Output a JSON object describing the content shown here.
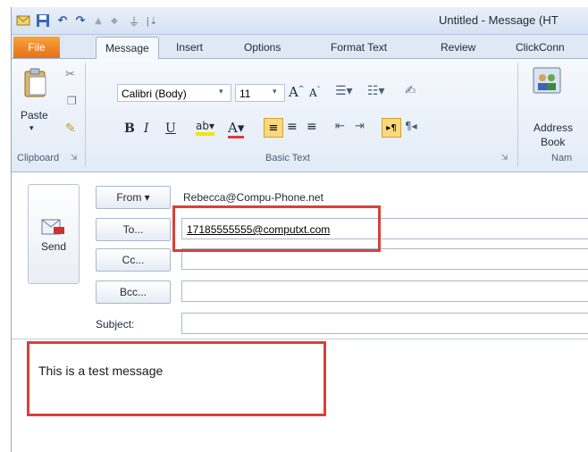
{
  "window": {
    "title": "Untitled - Message (HT"
  },
  "quick_access": {
    "icons": [
      "outlook-icon",
      "save-icon",
      "undo-icon",
      "redo-icon",
      "up-arrow-icon",
      "down-arrow-icon",
      "attach-icon",
      "customize-icon"
    ]
  },
  "tabs": {
    "file": "File",
    "message": "Message",
    "insert": "Insert",
    "options": "Options",
    "format_text": "Format Text",
    "review": "Review",
    "clickconn": "ClickConn"
  },
  "ribbon": {
    "paste": "Paste",
    "clipboard_label": "Clipboard",
    "font_name": "Calibri (Body)",
    "font_size": "11",
    "bold": "B",
    "italic": "I",
    "underline": "U",
    "basic_text_label": "Basic Text",
    "address_book_line1": "Address",
    "address_book_line2": "Book",
    "names_label": "Nam"
  },
  "header": {
    "send": "Send",
    "from_btn": "From ▾",
    "from_value": "Rebecca@Compu-Phone.net",
    "to_btn": "To...",
    "to_value": "17185555555@computxt.com",
    "cc_btn": "Cc...",
    "bcc_btn": "Bcc...",
    "subject_label": "Subject:"
  },
  "body": {
    "text": "This is a test message"
  },
  "colors": {
    "file_tab": "#e5701a",
    "highlight_box": "#d9403b"
  }
}
